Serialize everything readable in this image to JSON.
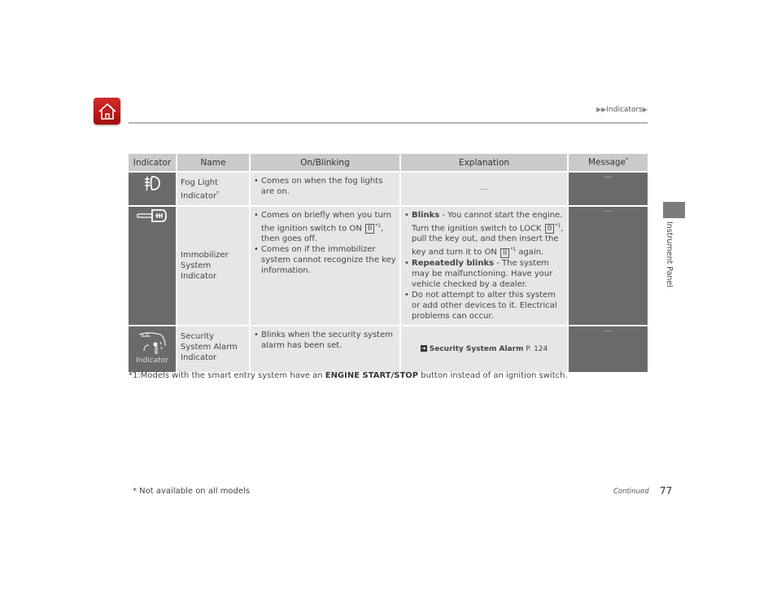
{
  "header": {
    "home_icon": "home-icon",
    "breadcrumb": {
      "prefix": "▶▶",
      "section": "Indicators",
      "suffix": "▶"
    }
  },
  "side_tab": {
    "label": "Instrument Panel"
  },
  "table": {
    "columns": [
      "Indicator",
      "Name",
      "On/Blinking",
      "Explanation",
      "Message"
    ],
    "message_marker": "*",
    "rows": [
      {
        "icon": "fog-light-icon",
        "name": "Fog Light Indicator",
        "name_marker": "*",
        "on_blinking": [
          "Comes on when the fog lights are on."
        ],
        "explanation": "—",
        "message": "—"
      },
      {
        "icon": "immobilizer-key-icon",
        "name": "Immobilizer System Indicator",
        "on_blinking": [
          {
            "before": "Comes on briefly when you turn the ignition switch to ON ",
            "key": "II",
            "sup": "*1",
            "after": ", then goes off."
          },
          {
            "text": "Comes on if the immobilizer system cannot recognize the key information."
          }
        ],
        "explanation": [
          {
            "bold": "Blinks",
            "text1": " - You cannot start the engine. Turn the ignition switch to LOCK ",
            "key1": "0",
            "sup1": "*1",
            "text2": ", pull the key out, and then insert the key and turn it to ON ",
            "key2": "II",
            "sup2": "*1",
            "text3": " again."
          },
          {
            "bold": "Repeatedly blinks",
            "text1": " - The system may be malfunctioning. Have your vehicle checked by a dealer."
          },
          {
            "text1": "Do not attempt to alter this system or add other devices to it. Electrical problems can occur."
          }
        ],
        "message": "—"
      },
      {
        "icon": "security-alarm-icon",
        "icon_caption": "Indicator",
        "name": "Security System Alarm Indicator",
        "on_blinking": [
          "Blinks when the security system alarm has been set."
        ],
        "explanation_xref": {
          "icon": "xref-arrow-icon",
          "title": "Security System Alarm",
          "page": "P. 124"
        },
        "message": "—"
      }
    ]
  },
  "footnote1": {
    "prefix": "*1:Models with the smart entry system have an ",
    "bold": "ENGINE START/STOP",
    "suffix": " button instead of an ignition switch."
  },
  "footer": {
    "note": "* Not available on all models",
    "continued": "Continued",
    "page_number": "77"
  }
}
